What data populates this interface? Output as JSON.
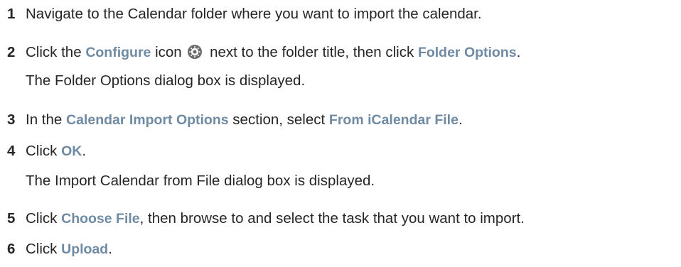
{
  "steps": [
    {
      "number": "1",
      "parts": [
        "Navigate to the Calendar folder where you want to import the calendar."
      ]
    },
    {
      "number": "2",
      "p1": "Click the ",
      "ui1": "Configure",
      "p2": " icon ",
      "icon": "gear-icon",
      "p3": " next to the folder title, then click ",
      "ui2": "Folder Options",
      "p4": ".",
      "result": "The Folder Options dialog box is displayed."
    },
    {
      "number": "3",
      "p1": "In the ",
      "ui1": "Calendar Import Options",
      "p2": " section, select ",
      "ui2": "From iCalendar File",
      "p3": "."
    },
    {
      "number": "4",
      "p1": "Click ",
      "ui1": "OK",
      "p2": ".",
      "result": "The Import Calendar from File dialog box is displayed."
    },
    {
      "number": "5",
      "p1": "Click ",
      "ui1": "Choose File",
      "p2": ", then browse to and select the task that you want to import."
    },
    {
      "number": "6",
      "p1": "Click ",
      "ui1": "Upload",
      "p2": "."
    }
  ],
  "colors": {
    "ui_term": "#6f8aa3",
    "body_text": "#262626",
    "icon": "#6b6b6b"
  }
}
